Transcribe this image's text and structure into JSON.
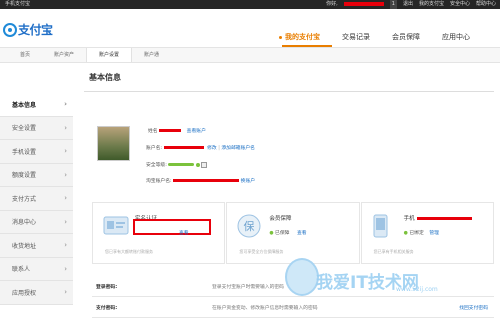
{
  "topbar": {
    "left_text": "手机支付宝",
    "greeting": "你好,",
    "counter": "1",
    "logout": "退出",
    "my_alipay": "我的支付宝",
    "security_center": "安全中心",
    "help_center": "帮助中心"
  },
  "header": {
    "logo_text": "支付宝",
    "nav": [
      {
        "label": "我的支付宝",
        "active": true
      },
      {
        "label": "交易记录",
        "active": false
      },
      {
        "label": "会员保障",
        "active": false
      },
      {
        "label": "应用中心",
        "active": false
      }
    ],
    "subnav": [
      {
        "label": "首页",
        "active": false
      },
      {
        "label": "账户资产",
        "active": false
      },
      {
        "label": "账户设置",
        "active": true
      },
      {
        "label": "账户通",
        "active": false
      }
    ]
  },
  "sidebar": {
    "items": [
      {
        "label": "基本信息",
        "active": true
      },
      {
        "label": "安全设置",
        "active": false
      },
      {
        "label": "手机设置",
        "active": false
      },
      {
        "label": "额度设置",
        "active": false
      },
      {
        "label": "支付方式",
        "active": false
      },
      {
        "label": "消息中心",
        "active": false
      },
      {
        "label": "收货地址",
        "active": false
      },
      {
        "label": "联系人",
        "active": false
      },
      {
        "label": "应用授权",
        "active": false
      }
    ]
  },
  "main": {
    "title": "基本信息",
    "profile": {
      "name_label": "姓名",
      "name_link": "查看账户",
      "account_label": "账户名:",
      "account_edit": "修改",
      "account_add": "添加邮箱账户名",
      "security_label": "安全等级:",
      "taobao_label": "淘宝账户名:",
      "taobao_link": "换账户"
    },
    "cards": [
      {
        "title": "实名认证",
        "status": "",
        "action": "查看",
        "desc": "您已享有大额转账付款服务",
        "icon": "id-card-icon"
      },
      {
        "title": "会员保障",
        "status": "已保障",
        "action": "查看",
        "desc": "您可享受全方位保障服务",
        "icon": "shield-icon"
      },
      {
        "title": "手机",
        "status": "已绑定",
        "action": "管理",
        "desc": "您已享有手机相关服务",
        "icon": "phone-icon"
      }
    ],
    "rows": [
      {
        "label": "登录密码:",
        "desc": "登录支付宝账户时需要输入的密码",
        "action": ""
      },
      {
        "label": "支付密码:",
        "desc": "在账户资金变动、修改账户信息时需要输入的密码",
        "action": "找回支付密码"
      }
    ]
  },
  "watermark": {
    "text": "我爱IT技术网",
    "url": "www.52ij.com"
  }
}
